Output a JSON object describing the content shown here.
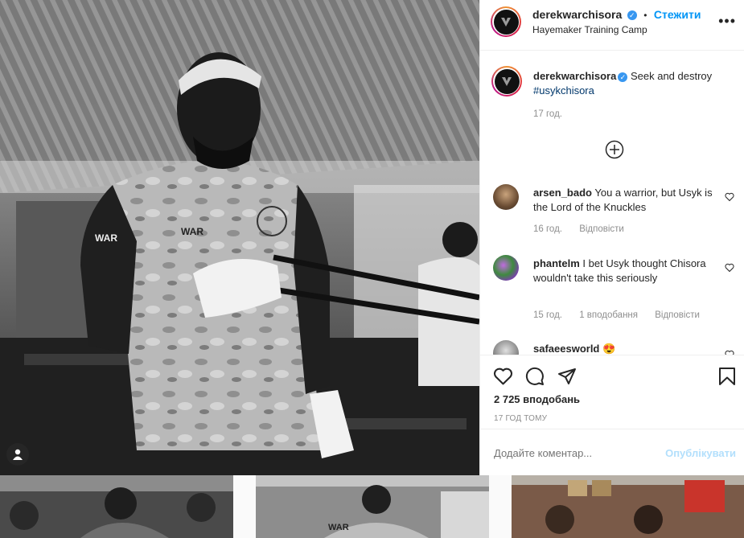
{
  "header": {
    "username": "derekwarchisora",
    "dot": "•",
    "follow_label": "Стежити",
    "location": "Hayemaker Training Camp"
  },
  "caption": {
    "username": "derekwarchisora",
    "text": "Seek and destroy",
    "hashtag": "#usykchisora",
    "time": "17 год."
  },
  "comments": [
    {
      "username": "arsen_bado",
      "text": "You a warrior, but Usyk is the Lord of the Knuckles",
      "time": "16 год.",
      "reply": "Відповісти"
    },
    {
      "username": "phantelm",
      "text": "I bet Usyk thought Chisora wouldn't take this seriously",
      "time": "15 год.",
      "likes": "1 вподобання",
      "reply": "Відповісти"
    },
    {
      "username": "safaeesworld",
      "emoji": "😍"
    }
  ],
  "likes_count": "2 725 вподобань",
  "posted_ago": "17 ГОД ТОМУ",
  "comment_input": {
    "placeholder": "Додайте коментар..."
  },
  "post_button": "Опублікувати",
  "colors": {
    "accent": "#0095f6",
    "muted": "#8e8e8e",
    "post_disabled": "#b2dffc",
    "hashtag": "#00376b"
  },
  "icons": [
    "verified-badge-icon",
    "more-options-icon",
    "load-more-icon",
    "heart-icon",
    "comment-icon",
    "share-icon",
    "bookmark-icon",
    "user-tag-icon"
  ]
}
